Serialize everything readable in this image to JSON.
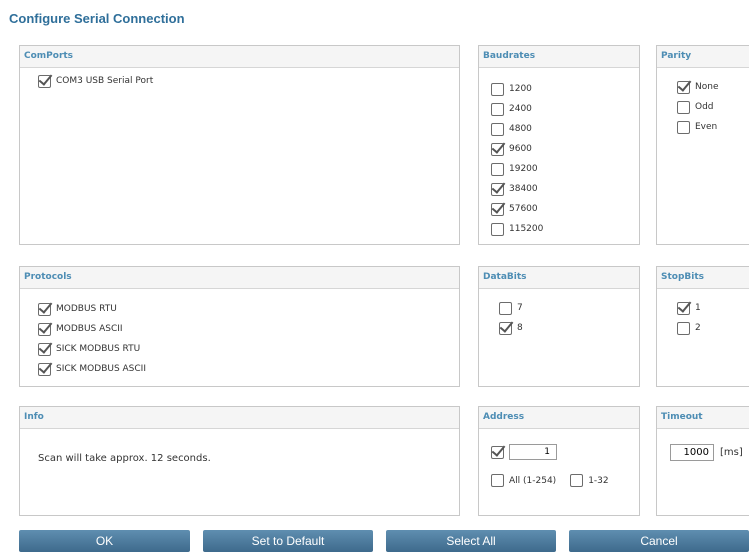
{
  "dialog": {
    "title": "Configure Serial Connection"
  },
  "comports": {
    "header": "ComPorts",
    "items": [
      {
        "label": "COM3 USB Serial Port",
        "checked": true
      }
    ]
  },
  "baudrates": {
    "header": "Baudrates",
    "items": [
      {
        "label": "1200",
        "checked": false
      },
      {
        "label": "2400",
        "checked": false
      },
      {
        "label": "4800",
        "checked": false
      },
      {
        "label": "9600",
        "checked": true
      },
      {
        "label": "19200",
        "checked": false
      },
      {
        "label": "38400",
        "checked": true
      },
      {
        "label": "57600",
        "checked": true
      },
      {
        "label": "115200",
        "checked": false
      }
    ]
  },
  "parity": {
    "header": "Parity",
    "items": [
      {
        "label": "None",
        "checked": true
      },
      {
        "label": "Odd",
        "checked": false
      },
      {
        "label": "Even",
        "checked": false
      }
    ]
  },
  "protocols": {
    "header": "Protocols",
    "items": [
      {
        "label": "MODBUS RTU",
        "checked": true
      },
      {
        "label": "MODBUS ASCII",
        "checked": true
      },
      {
        "label": "SICK MODBUS RTU",
        "checked": true
      },
      {
        "label": "SICK MODBUS ASCII",
        "checked": true
      }
    ]
  },
  "databits": {
    "header": "DataBits",
    "items": [
      {
        "label": "7",
        "checked": false
      },
      {
        "label": "8",
        "checked": true
      }
    ]
  },
  "stopbits": {
    "header": "StopBits",
    "items": [
      {
        "label": "1",
        "checked": true
      },
      {
        "label": "2",
        "checked": false
      }
    ]
  },
  "info": {
    "header": "Info",
    "text": "Scan will take approx.  12 seconds."
  },
  "address": {
    "header": "Address",
    "enabled": true,
    "value": "1",
    "all_label": "All (1-254)",
    "all_checked": false,
    "range_label": "1-32",
    "range_checked": false
  },
  "timeout": {
    "header": "Timeout",
    "value": "1000",
    "unit": "[ms]"
  },
  "buttons": {
    "ok": "OK",
    "default": "Set to Default",
    "select_all": "Select All",
    "cancel": "Cancel"
  },
  "colors": {
    "header_text": "#4d8db4",
    "title_text": "#2f6f9a",
    "button": "#4d7ca0"
  }
}
